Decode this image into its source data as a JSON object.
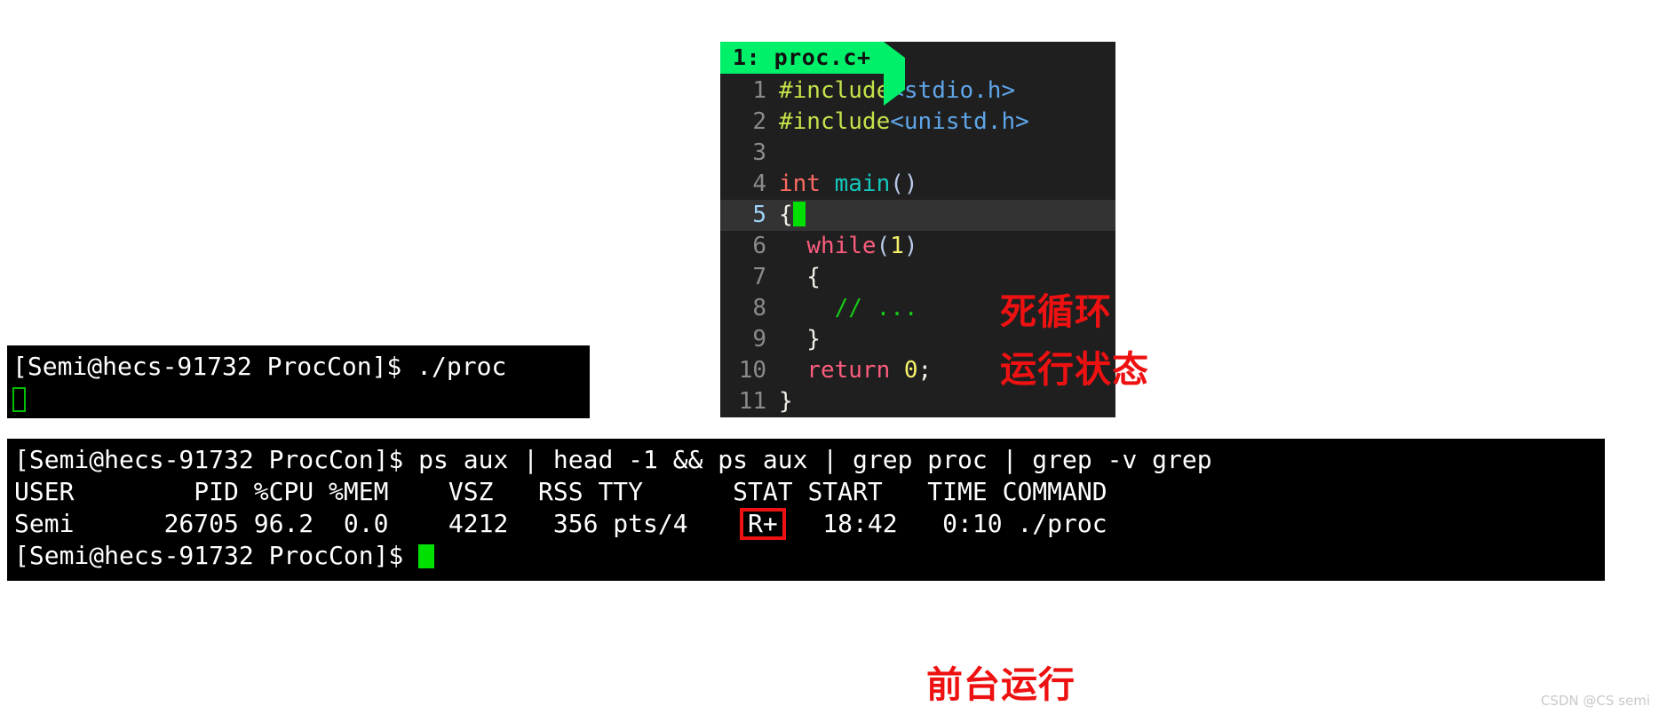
{
  "editor": {
    "tab_label": "1: proc.c+",
    "lines": [
      {
        "num": "1",
        "current": false,
        "segments": [
          {
            "t": "#include",
            "c": "tok-pre"
          },
          {
            "t": "<stdio.h>",
            "c": "tok-hdr"
          }
        ]
      },
      {
        "num": "2",
        "current": false,
        "segments": [
          {
            "t": "#include",
            "c": "tok-pre"
          },
          {
            "t": "<unistd.h>",
            "c": "tok-hdr"
          }
        ]
      },
      {
        "num": "3",
        "current": false,
        "segments": []
      },
      {
        "num": "4",
        "current": false,
        "segments": [
          {
            "t": "int ",
            "c": "tok-type"
          },
          {
            "t": "main",
            "c": "tok-fn"
          },
          {
            "t": "()",
            "c": "tok-paren"
          }
        ]
      },
      {
        "num": "5",
        "current": true,
        "segments": [
          {
            "t": "{",
            "c": "tok-punct"
          }
        ],
        "cursor": "block"
      },
      {
        "num": "6",
        "current": false,
        "segments": [
          {
            "t": "  ",
            "c": "ctext"
          },
          {
            "t": "while",
            "c": "tok-kw"
          },
          {
            "t": "(",
            "c": "tok-paren"
          },
          {
            "t": "1",
            "c": "tok-num"
          },
          {
            "t": ")",
            "c": "tok-paren"
          }
        ]
      },
      {
        "num": "7",
        "current": false,
        "segments": [
          {
            "t": "  {",
            "c": "tok-punct"
          }
        ]
      },
      {
        "num": "8",
        "current": false,
        "segments": [
          {
            "t": "    // ...",
            "c": "tok-cmt"
          }
        ]
      },
      {
        "num": "9",
        "current": false,
        "segments": [
          {
            "t": "  }",
            "c": "tok-punct"
          }
        ]
      },
      {
        "num": "10",
        "current": false,
        "segments": [
          {
            "t": "  ",
            "c": "ctext"
          },
          {
            "t": "return ",
            "c": "tok-kw"
          },
          {
            "t": "0",
            "c": "tok-num"
          },
          {
            "t": ";",
            "c": "tok-punct"
          }
        ]
      },
      {
        "num": "11",
        "current": false,
        "segments": [
          {
            "t": "}",
            "c": "tok-punct"
          }
        ]
      }
    ]
  },
  "annotations": {
    "infinite_loop": "死循环",
    "running_state": "运行状态",
    "foreground_run": "前台运行",
    "color": "#ee1111"
  },
  "terminal_run": {
    "prompt_line": "[Semi@hecs-91732 ProcCon]$ ./proc",
    "cursor_style": "hollow-green"
  },
  "terminal_ps": {
    "command_line": "[Semi@hecs-91732 ProcCon]$ ps aux | head -1 && ps aux | grep proc | grep -v grep",
    "header": "USER        PID %CPU %MEM    VSZ   RSS TTY      STAT START   TIME COMMAND",
    "row_before_stat": "Semi      26705 96.2  0.0    4212   356 pts/4    ",
    "row_stat": "R+",
    "row_after_stat": "   18:42   0:10 ./proc",
    "final_prompt": "[Semi@hecs-91732 ProcCon]$ ",
    "stat_highlight_color": "#ee1111",
    "cursor_style": "solid-green"
  },
  "watermark": {
    "text": "CSDN @CS semi"
  }
}
